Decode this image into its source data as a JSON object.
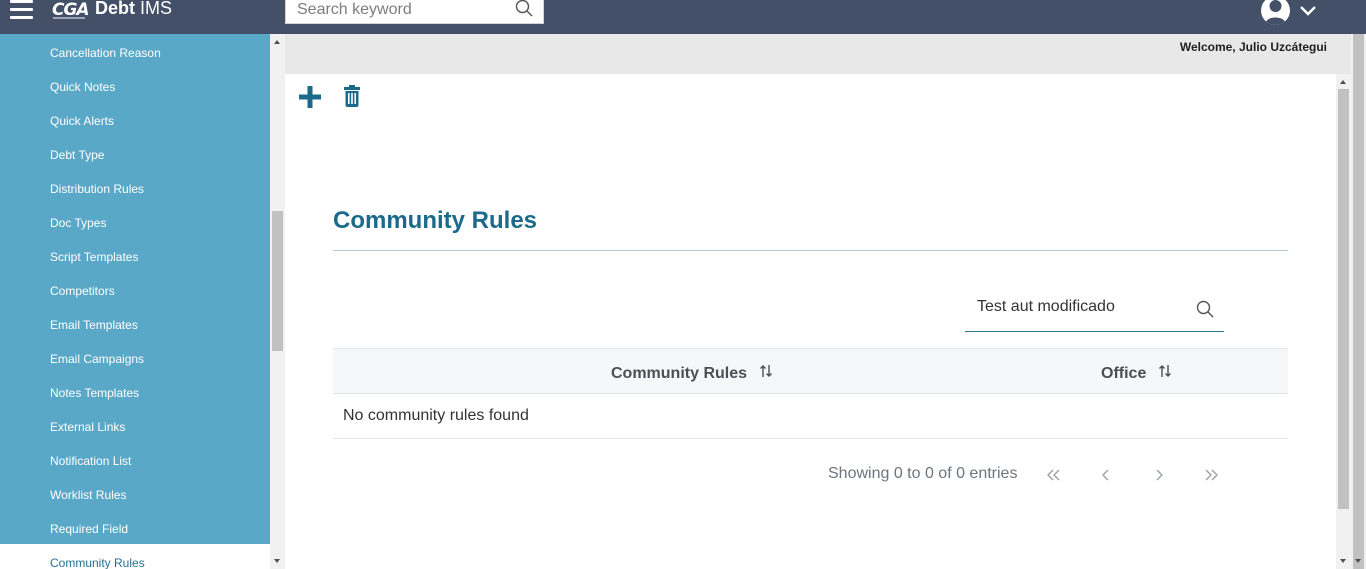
{
  "app": {
    "logo_text": "CGA",
    "title_bold": "Debt",
    "title_light": "IMS"
  },
  "header": {
    "search_placeholder": "Search keyword"
  },
  "welcome": "Welcome, Julio Uzcátegui",
  "sidebar": {
    "items": [
      {
        "label": "Cancellation Reason"
      },
      {
        "label": "Quick Notes"
      },
      {
        "label": "Quick Alerts"
      },
      {
        "label": "Debt Type"
      },
      {
        "label": "Distribution Rules"
      },
      {
        "label": "Doc Types"
      },
      {
        "label": "Script Templates"
      },
      {
        "label": "Competitors"
      },
      {
        "label": "Email Templates"
      },
      {
        "label": "Email Campaigns"
      },
      {
        "label": "Notes Templates"
      },
      {
        "label": "External Links"
      },
      {
        "label": "Notification List"
      },
      {
        "label": "Worklist Rules"
      },
      {
        "label": "Required Field"
      },
      {
        "label": "Community Rules",
        "active": true
      }
    ]
  },
  "page": {
    "title": "Community Rules",
    "filter_value": "Test aut modificado",
    "columns": [
      "Community Rules",
      "Office"
    ],
    "empty_message": "No community rules found",
    "paginator": {
      "report": "Showing 0 to 0 of 0 entries",
      "first": "«",
      "prev": "‹",
      "next": "›",
      "last": "»"
    }
  },
  "colors": {
    "topbar": "#445068",
    "sidebar": "#5aa8c8",
    "accent": "#1c6a8a"
  },
  "icons": {
    "add": "plus-icon",
    "delete": "trash-icon",
    "search": "search-icon",
    "user": "user-icon",
    "sort": "sort-icon"
  }
}
